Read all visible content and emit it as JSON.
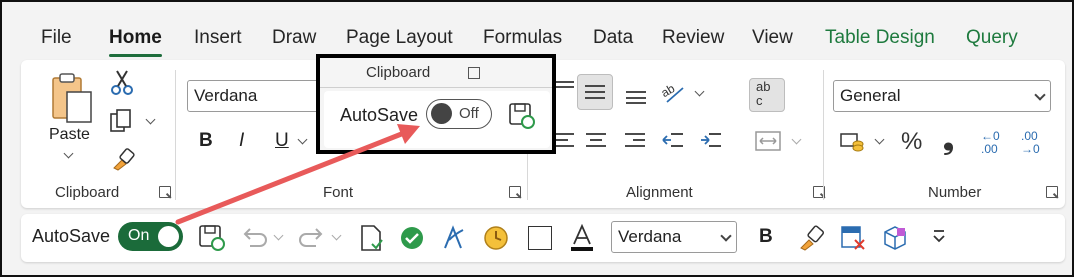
{
  "tabs": [
    {
      "label": "File"
    },
    {
      "label": "Home"
    },
    {
      "label": "Insert"
    },
    {
      "label": "Draw"
    },
    {
      "label": "Page Layout"
    },
    {
      "label": "Formulas"
    },
    {
      "label": "Data"
    },
    {
      "label": "Review"
    },
    {
      "label": "View"
    },
    {
      "label": "Table Design"
    },
    {
      "label": "Query"
    }
  ],
  "clipboard": {
    "paste_label": "Paste",
    "group_label": "Clipboard"
  },
  "font": {
    "family_value": "Verdana",
    "group_label": "Font"
  },
  "alignment": {
    "group_label": "Alignment",
    "wrap_text": "ab c"
  },
  "number": {
    "format_value": "General",
    "percent": "%",
    "comma": "❟",
    "group_label": "Number",
    "inc_decimal": "←0 .00",
    "dec_decimal": ".00 →0"
  },
  "qat": {
    "autosave_label": "AutoSave",
    "autosave_state": "On",
    "font_value": "Verdana",
    "bold": "B"
  },
  "callout": {
    "clipboard_label": "Clipboard",
    "autosave_label": "AutoSave",
    "autosave_state": "Off"
  },
  "colors": {
    "accent": "#1b6b3a",
    "arrow": "#e85a5a",
    "tab_green": "#1e7a3e"
  }
}
